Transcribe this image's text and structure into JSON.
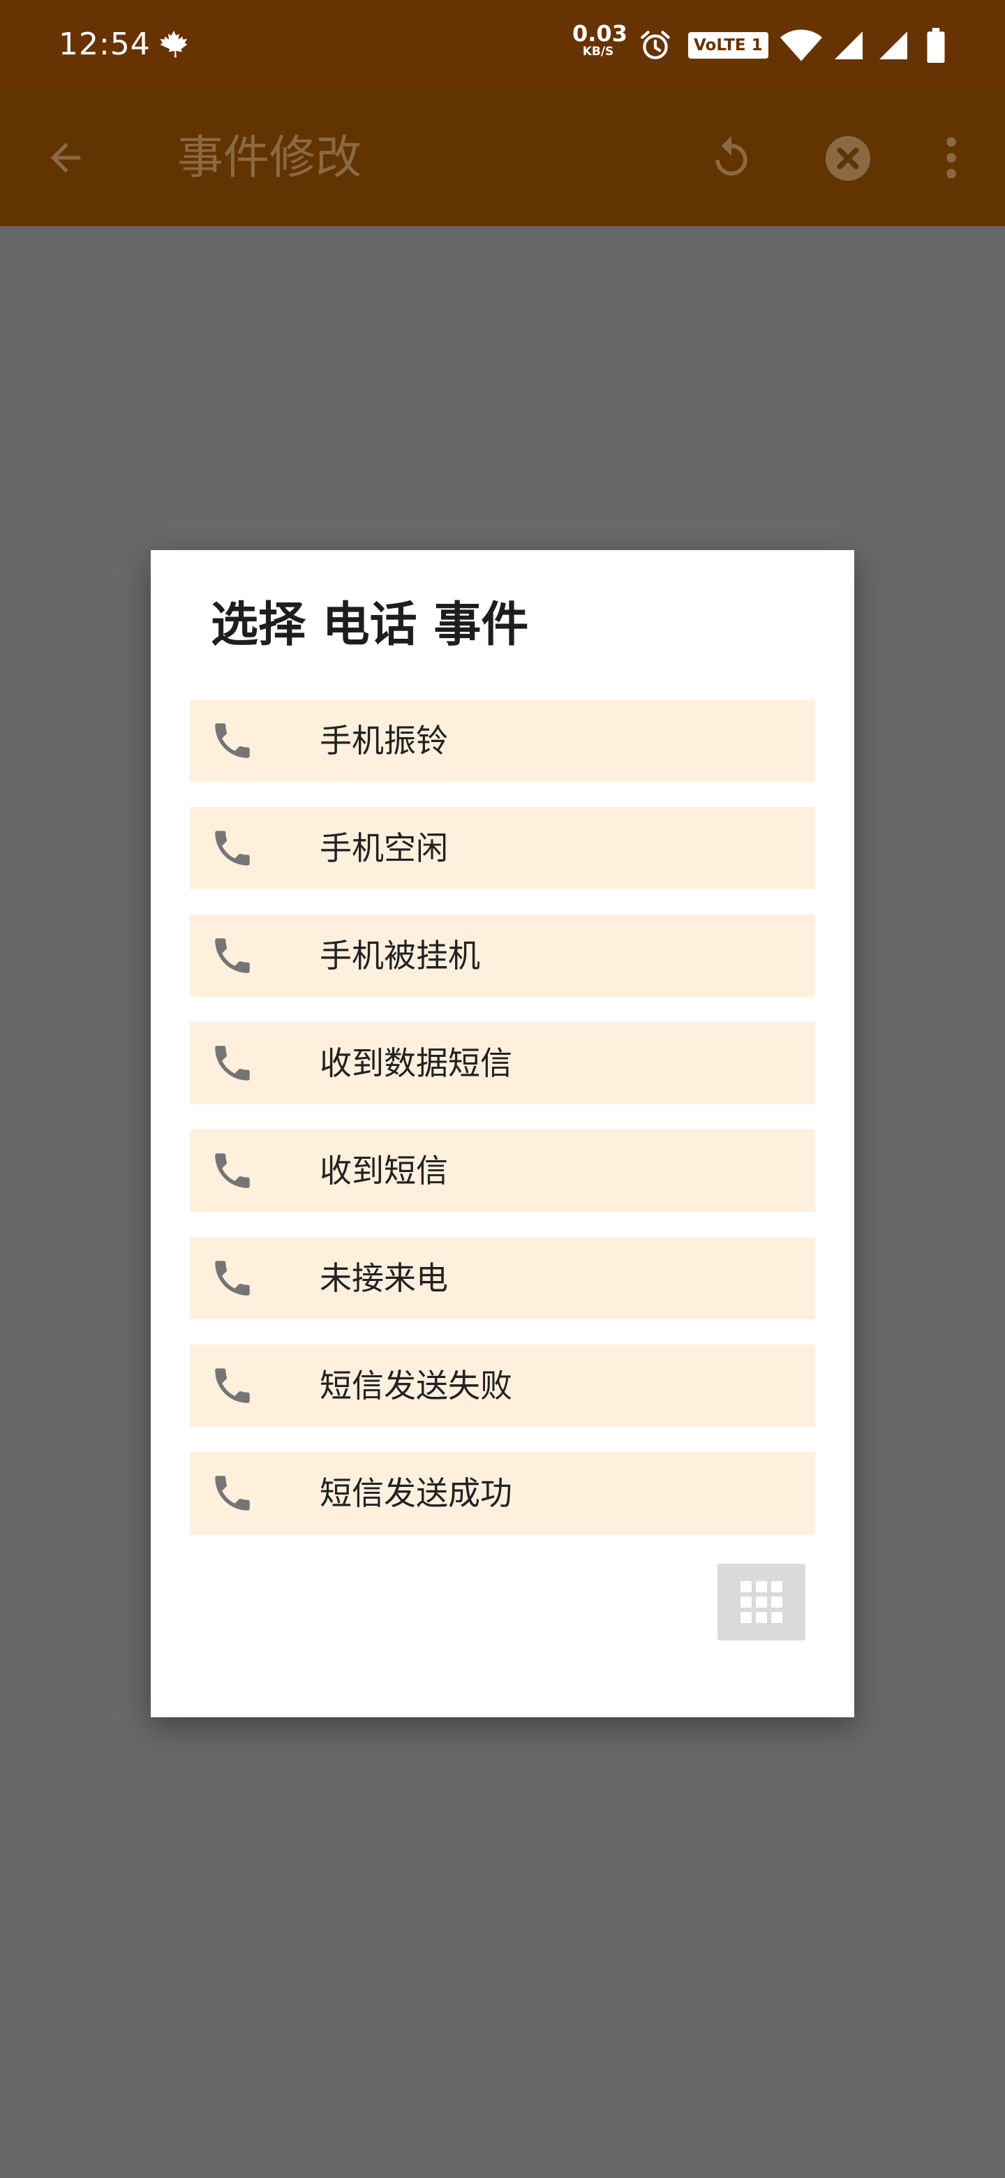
{
  "status_bar": {
    "time": "12:54",
    "net_speed_value": "0.03",
    "net_speed_unit": "KB/S",
    "volte_badge": "VoLTE 1",
    "icons": [
      "maple-leaf-icon",
      "alarm-icon",
      "wifi-icon",
      "signal-icon",
      "signal-icon",
      "battery-icon"
    ]
  },
  "toolbar": {
    "title": "事件修改",
    "icons": [
      "back-arrow-icon",
      "refresh-icon",
      "close-circle-icon",
      "more-vert-icon"
    ]
  },
  "dialog": {
    "title": "选择 电话 事件",
    "items": [
      {
        "label": "手机振铃",
        "icon": "phone-icon"
      },
      {
        "label": "手机空闲",
        "icon": "phone-icon"
      },
      {
        "label": "手机被挂机",
        "icon": "phone-icon"
      },
      {
        "label": "收到数据短信",
        "icon": "phone-icon"
      },
      {
        "label": "收到短信",
        "icon": "phone-icon"
      },
      {
        "label": "未接来电",
        "icon": "phone-icon"
      },
      {
        "label": "短信发送失败",
        "icon": "phone-icon"
      },
      {
        "label": "短信发送成功",
        "icon": "phone-icon"
      }
    ],
    "grid_button_icon": "grid-icon"
  },
  "colors": {
    "status_bar": "#683302",
    "toolbar": "#623402",
    "scrim": "#686868",
    "item_background": "#fff0de",
    "phone_icon": "#757575"
  }
}
